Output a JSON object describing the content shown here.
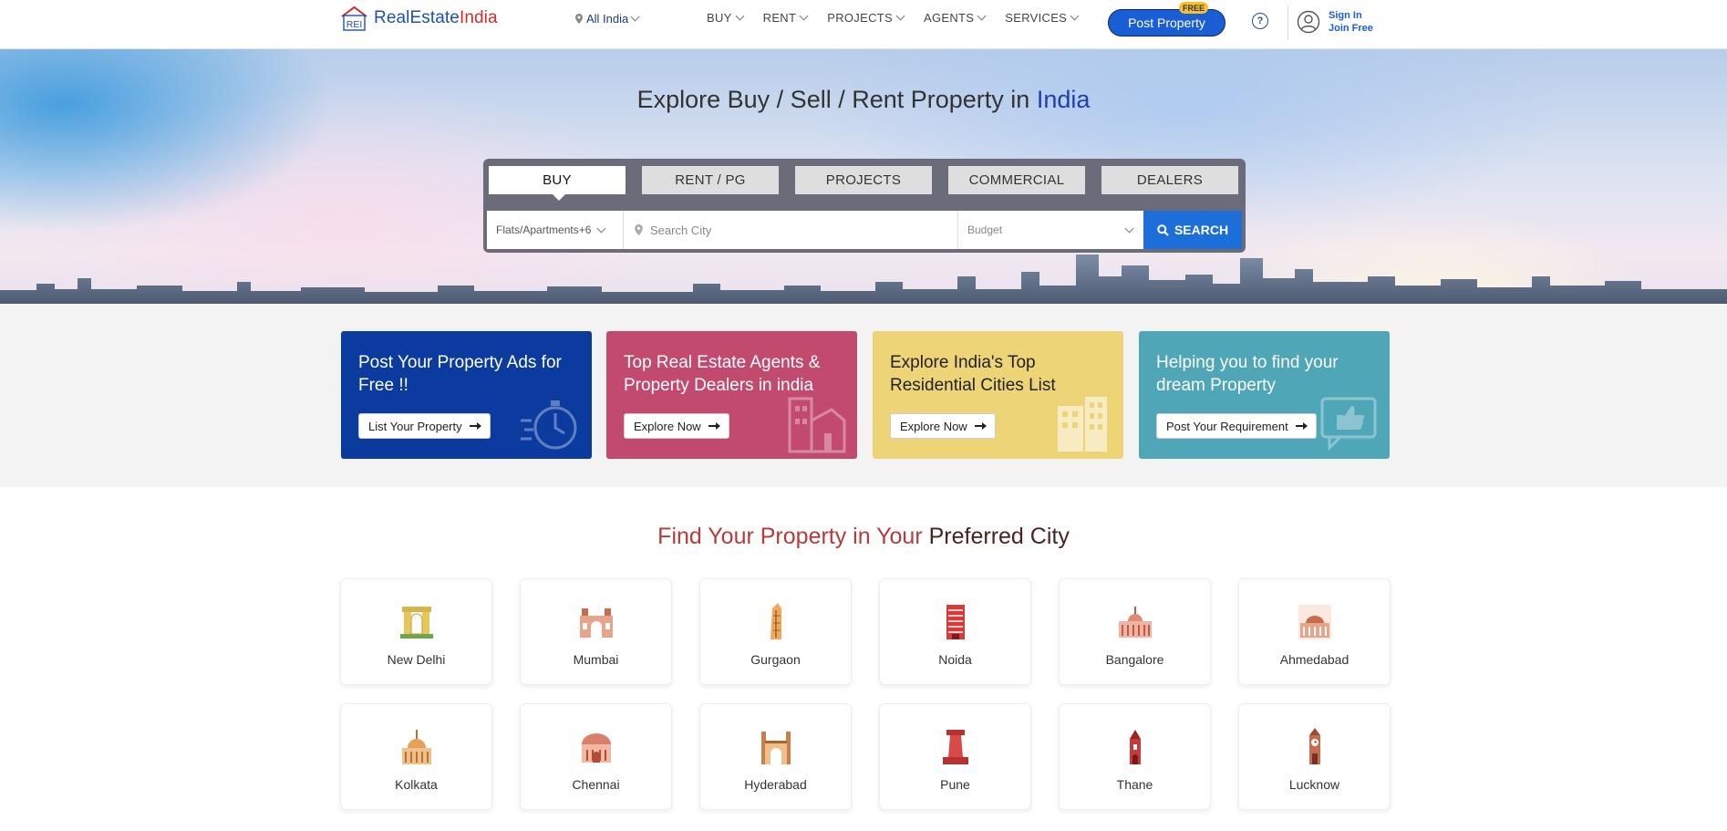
{
  "header": {
    "logo_mark": "REI",
    "logo_brand_a": "RealEstate",
    "logo_brand_b": "India",
    "location": "All India",
    "nav": [
      "BUY",
      "RENT",
      "PROJECTS",
      "AGENTS",
      "SERVICES"
    ],
    "post_property": "Post Property",
    "free_badge": "FREE",
    "help_glyph": "?",
    "sign_in": "Sign In",
    "join_free": "Join Free"
  },
  "hero": {
    "title_prefix": "Explore Buy / Sell / Rent Property in ",
    "title_highlight": "India",
    "tabs": [
      "BUY",
      "RENT / PG",
      "PROJECTS",
      "COMMERCIAL",
      "DEALERS"
    ],
    "active_tab": "BUY",
    "property_type": "Flats/Apartments+6",
    "city_placeholder": "Search City",
    "budget_placeholder": "Budget",
    "search_label": "SEARCH"
  },
  "promo_cards": [
    {
      "title": "Post Your Property Ads for Free !!",
      "button": "List Your Property",
      "bg": "#0b3b9e",
      "icon": "stopwatch-icon"
    },
    {
      "title": "Top Real Estate Agents & Property Dealers in india",
      "button": "Explore Now",
      "bg": "#c24a6f",
      "icon": "buildings-icon"
    },
    {
      "title": "Explore India's Top Residential Cities List",
      "button": "Explore Now",
      "bg": "#ecd477",
      "icon": "apartment-icon"
    },
    {
      "title": "Helping you to find your dream Property",
      "button": "Post Your Requirement",
      "bg": "#4ea6b7",
      "icon": "thumbs-up-icon"
    }
  ],
  "cities_section": {
    "heading_a": "Find Your Property in Your ",
    "heading_b": "Preferred City",
    "cities": [
      "New Delhi",
      "Mumbai",
      "Gurgaon",
      "Noida",
      "Bangalore",
      "Ahmedabad",
      "Kolkata",
      "Chennai",
      "Hyderabad",
      "Pune",
      "Thane",
      "Lucknow"
    ]
  },
  "colors": {
    "brand_blue": "#1d4fb8",
    "brand_red": "#d42a2a",
    "search_button": "#1c6fd9",
    "post_button": "#1a5ed6"
  }
}
